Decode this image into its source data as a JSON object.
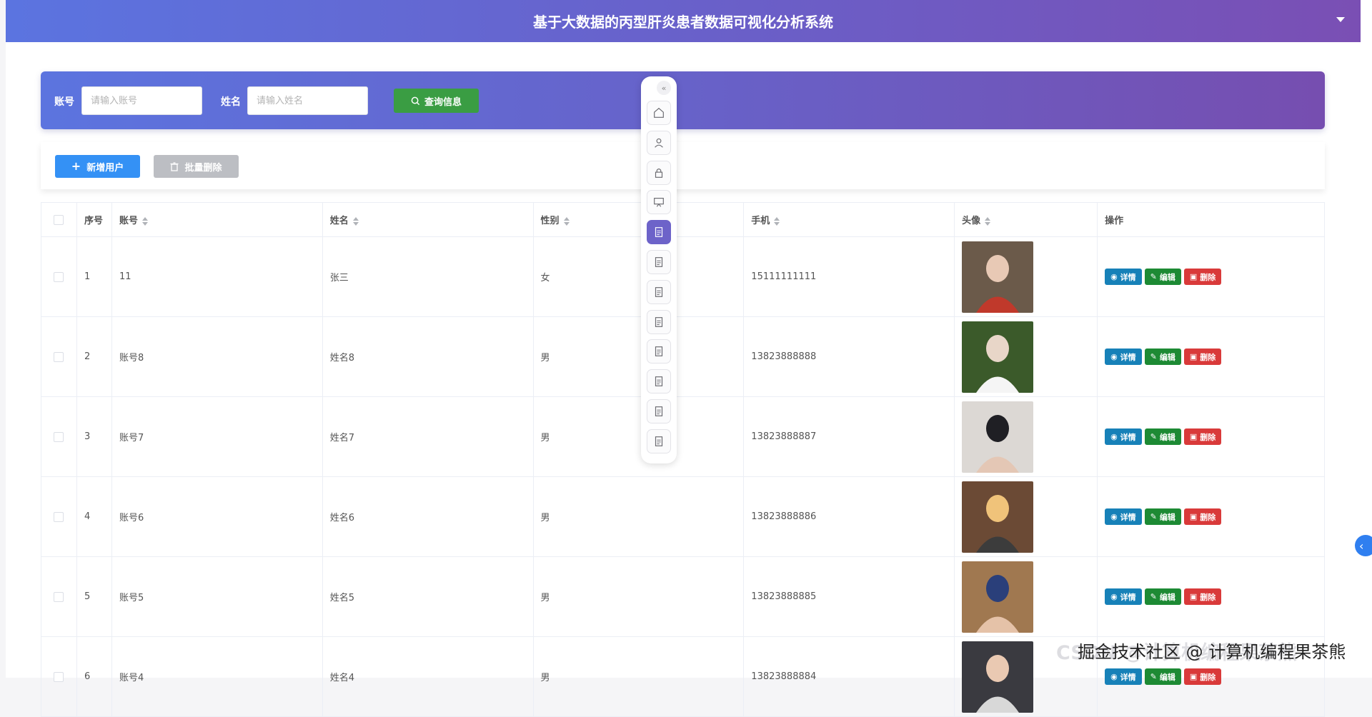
{
  "header": {
    "title": "基于大数据的丙型肝炎患者数据可视化分析系统"
  },
  "search": {
    "account_label": "账号",
    "account_placeholder": "请输入账号",
    "name_label": "姓名",
    "name_placeholder": "请输入姓名",
    "query_label": "查询信息"
  },
  "actions": {
    "add_label": "新增用户",
    "batch_delete_label": "批量删除"
  },
  "table": {
    "headers": {
      "index": "序号",
      "account": "账号",
      "name": "姓名",
      "gender": "性别",
      "phone": "手机",
      "avatar": "头像",
      "ops": "操作"
    },
    "rows": [
      {
        "index": "1",
        "account": "11",
        "name": "张三",
        "gender": "女",
        "phone": "15111111111"
      },
      {
        "index": "2",
        "account": "账号8",
        "name": "姓名8",
        "gender": "男",
        "phone": "13823888888"
      },
      {
        "index": "3",
        "account": "账号7",
        "name": "姓名7",
        "gender": "男",
        "phone": "13823888887"
      },
      {
        "index": "4",
        "account": "账号6",
        "name": "姓名6",
        "gender": "男",
        "phone": "13823888886"
      },
      {
        "index": "5",
        "account": "账号5",
        "name": "姓名5",
        "gender": "男",
        "phone": "13823888885"
      },
      {
        "index": "6",
        "account": "账号4",
        "name": "姓名4",
        "gender": "男",
        "phone": "13823888884"
      }
    ],
    "op_labels": {
      "detail": "详情",
      "edit": "编辑",
      "delete": "删除"
    }
  },
  "watermark": {
    "back": "CSDN @计算机编程果茶熊",
    "front": "掘金技术社区 @ 计算机编程果茶熊"
  },
  "colors": {
    "header_gradient_start": "#5b74e0",
    "header_gradient_end": "#7a4fb4",
    "query_button": "#3a9d43",
    "add_button": "#3491f5",
    "detail": "#1781b8",
    "edit": "#1d8a34",
    "delete": "#d93a3a",
    "nav_active": "#6d63c9"
  },
  "nav_icons": [
    "home-icon",
    "user-icon",
    "lock-icon",
    "presentation-icon",
    "document-icon",
    "document-icon",
    "document-icon",
    "document-icon",
    "document-icon",
    "document-icon",
    "document-icon",
    "document-icon"
  ]
}
